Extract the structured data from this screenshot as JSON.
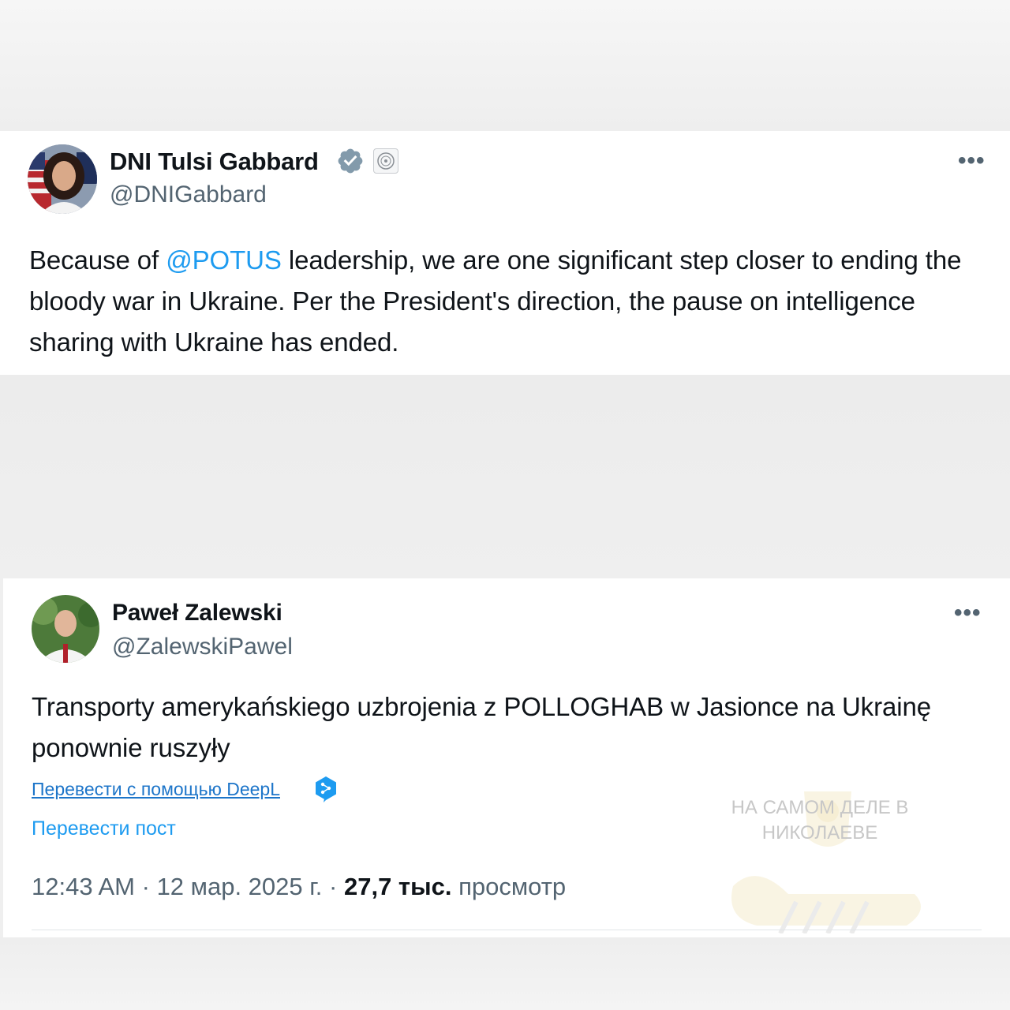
{
  "tweet1": {
    "display_name": "DNI Tulsi Gabbard",
    "handle": "@DNIGabbard",
    "verified_badge_icon": "verified-badge-icon",
    "affiliation_icon": "government-seal-icon",
    "more_label": "•••",
    "text_before": "Because of ",
    "mention": "@POTUS",
    "text_after": " leadership, we are one significant step closer to ending the bloody war in Ukraine. Per the President's direction, the pause on intelligence sharing with Ukraine has ended."
  },
  "tweet2": {
    "display_name": "Paweł Zalewski",
    "handle": "@ZalewskiPawel",
    "more_label": "•••",
    "text": "Transporty amerykańskiego uzbrojenia z POLLOGHAB w Jasionce na Ukrainę ponownie ruszyły",
    "translate_deepl": "Перевести с помощью DeepL",
    "deepl_icon": "deepl-icon",
    "translate_post": "Перевести пост",
    "time": "12:43 AM",
    "date": "12 мар. 2025 г.",
    "views_count": "27,7 тыс.",
    "views_label": "просмотр",
    "separator": "·"
  },
  "watermark": {
    "line1": "НА САМОМ ДЕЛЕ В",
    "line2": "НИКОЛАЕВЕ"
  },
  "colors": {
    "link": "#1d9bf0",
    "muted": "#536471",
    "text": "#0f1419",
    "verified": "#829aab"
  }
}
